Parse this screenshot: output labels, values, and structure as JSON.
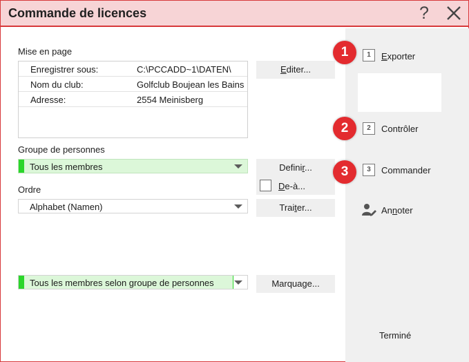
{
  "window": {
    "title": "Commande de licences"
  },
  "layout_section": {
    "label": "Mise en page",
    "rows": [
      {
        "key": "Enregistrer sous:",
        "value": "C:\\PCCADD~1\\DATEN\\"
      },
      {
        "key": "Nom du club:",
        "value": "Golfclub Boujean les Bains"
      },
      {
        "key": "Adresse:",
        "value": "2554 Meinisberg"
      }
    ],
    "edit_button": {
      "pre": "",
      "u": "E",
      "post": "diter..."
    }
  },
  "group_section": {
    "label": "Groupe de personnes",
    "selected": "Tous les membres",
    "define_button": {
      "pre": "Defini",
      "u": "r",
      "post": "..."
    },
    "deselect_label": {
      "pre": "",
      "u": "D",
      "post": "e-à..."
    }
  },
  "order_section": {
    "label": "Ordre",
    "selected": "Alphabet (Namen)",
    "process_button": {
      "pre": "Trai",
      "u": "t",
      "post": "er..."
    }
  },
  "mark_section": {
    "selected": "Tous les membres selon groupe de personnes",
    "mark_button": "Marquage..."
  },
  "side": {
    "steps": [
      {
        "badge": "1",
        "num": "1",
        "pre": "",
        "u": "E",
        "post": "xporter"
      },
      {
        "badge": "2",
        "num": "2",
        "pre": "Contrôler",
        "u": "",
        "post": ""
      },
      {
        "badge": "3",
        "num": "3",
        "pre": "Commander",
        "u": "",
        "post": ""
      }
    ],
    "annotate": {
      "pre": "An",
      "u": "n",
      "post": "oter"
    },
    "done": "Terminé"
  },
  "colors": {
    "accent_red": "#d7383a",
    "badge_red": "#e32b2f",
    "title_bg": "#f7d4d6",
    "group_green": "#2bd62b",
    "group_bg": "#dcf7d9"
  }
}
